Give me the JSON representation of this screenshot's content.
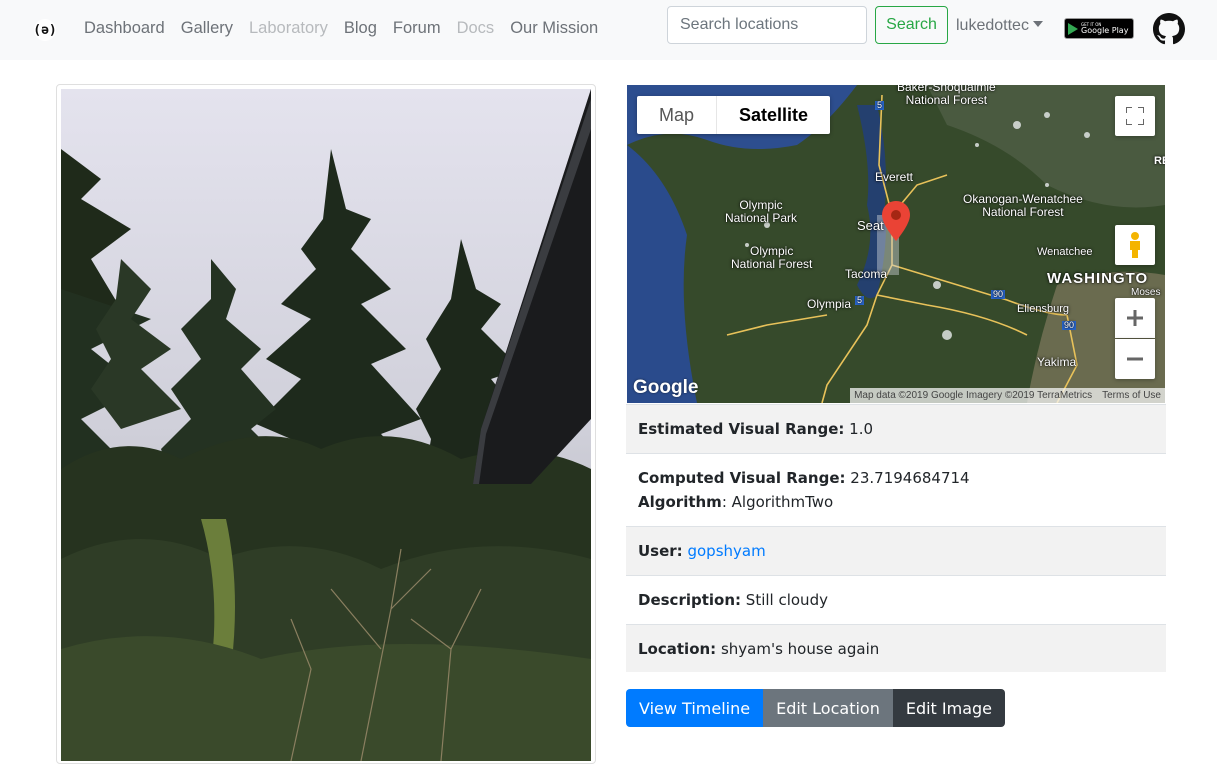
{
  "brand": {
    "logo_text": "(ə)"
  },
  "nav": {
    "links": [
      {
        "label": "Dashboard",
        "disabled": false
      },
      {
        "label": "Gallery",
        "disabled": false
      },
      {
        "label": "Laboratory",
        "disabled": true
      },
      {
        "label": "Blog",
        "disabled": false
      },
      {
        "label": "Forum",
        "disabled": false
      },
      {
        "label": "Docs",
        "disabled": true
      },
      {
        "label": "Our Mission",
        "disabled": false
      }
    ],
    "search": {
      "placeholder": "Search locations",
      "button_label": "Search"
    },
    "user": {
      "name": "lukedottec"
    },
    "store_badge": {
      "top": "GET IT ON",
      "bottom": "Google Play"
    }
  },
  "map": {
    "toggle": {
      "map_label": "Map",
      "satellite_label": "Satellite",
      "active": "Satellite"
    },
    "logo": "Google",
    "attribution": "Map data ©2019 Google Imagery ©2019 TerraMetrics",
    "terms": "Terms of Use",
    "labels": {
      "snoqualmie": "Baker-Snoqualmie\nNational Forest",
      "everett": "Everett",
      "olympic_np": "Olympic\nNational Park",
      "seattle": "Seat",
      "okanogan": "Okanogan-Wenatchee\nNational Forest",
      "wenatchee": "Wenatchee",
      "olympic_nf": "Olympic\nNational Forest",
      "tacoma": "Tacoma",
      "washington": "WASHINGTO",
      "olympia": "Olympia",
      "moses": "Moses",
      "ellensburg": "Ellensburg",
      "yakima": "Yakima",
      "re": "RE",
      "i5": "5",
      "i90": "90"
    },
    "accent_colors": {
      "marker": "#ea4335",
      "pegman": "#f4b400"
    }
  },
  "details": {
    "estimated": {
      "label": "Estimated Visual Range:",
      "value": "1.0"
    },
    "computed": {
      "label": "Computed Visual Range:",
      "value": "23.7194684714"
    },
    "algorithm": {
      "label": "Algorithm",
      "value": "AlgorithmTwo"
    },
    "user": {
      "label": "User:",
      "value": "gopshyam"
    },
    "description": {
      "label": "Description:",
      "value": "Still cloudy"
    },
    "location": {
      "label": "Location:",
      "value": "shyam's house again"
    }
  },
  "actions": {
    "view_timeline": "View Timeline",
    "edit_location": "Edit Location",
    "edit_image": "Edit Image"
  },
  "colors": {
    "primary": "#007bff",
    "secondary": "#6c757d",
    "dark": "#343a40",
    "success": "#28a745"
  }
}
